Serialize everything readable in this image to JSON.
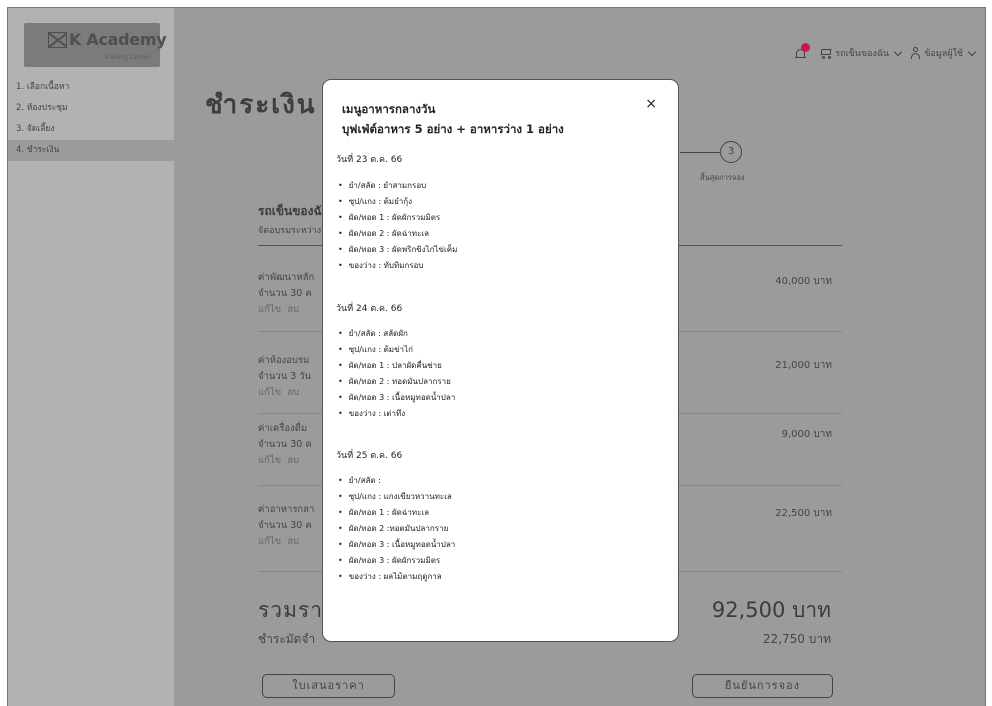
{
  "logo": {
    "name": "K Academy",
    "tagline": "Training Center"
  },
  "sidebar": {
    "items": [
      {
        "label": "1. เลือกเนื้อหา"
      },
      {
        "label": "2. ห้องประชุม"
      },
      {
        "label": "3. จัดเลี้ยง"
      },
      {
        "label": "4. ชำระเงิน"
      }
    ],
    "active_index": 3
  },
  "topbar": {
    "notification_color": "#c2185b",
    "cart_label": "รถเข็นของฉัน",
    "user_label": "ข้อมูลผู้ใช้"
  },
  "page": {
    "title": "ชำระเงิน",
    "stepper": {
      "step": "3",
      "label": "สิ้นสุดการจอง"
    },
    "section_title": "รถเข็นของฉัน",
    "section_sub": "จัดอบรมระหว่าง",
    "items": [
      {
        "line1": "ค่าพัฒนาหลัก",
        "line2": "จำนวน 30 ค",
        "edit": "แก้ไข",
        "remove": "ลบ",
        "price": "40,000 บาท"
      },
      {
        "line1": "ค่าห้องอบรม",
        "line2": "จำนวน 3 วัน",
        "edit": "แก้ไข",
        "remove": "ลบ",
        "price": "21,000 บาท"
      },
      {
        "line1": "ค่าเครื่องดื่ม",
        "line2": "จำนวน 30 ค",
        "edit": "แก้ไข",
        "remove": "ลบ",
        "price": "9,000 บาท"
      },
      {
        "line1": "ค่าอาหารกลา",
        "line2": "จำนวน 30 ค",
        "edit": "แก้ไข",
        "remove": "ลบ",
        "price": "22,500 บาท"
      }
    ],
    "total_label": "รวมราค",
    "total_value": "92,500 บาท",
    "deposit_label": "ชำระมัดจำ",
    "deposit_value": "22,750 บาท",
    "quote_button": "ใบเสนอราคา",
    "confirm_button": "ยืนยันการจอง"
  },
  "modal": {
    "title_line1": "เมนูอาหารกลางวัน",
    "title_line2": "บุฟเฟ่ต์อาหาร 5 อย่าง + อาหารว่าง 1 อย่าง",
    "close": "×",
    "days": [
      {
        "date": "วันที่ 23 ต.ค. 66",
        "items": [
          "ยำ/สลัด : ยำสามกรอบ",
          "ซุป/แกง : ต้มยำกุ้ง",
          "ผัด/ทอด 1 : ผัดผักรวมมิตร",
          "ผัด/ทอด  2 : ผัดฉ่าทะเล",
          "ผัด/ทอด  3 : ผัดพริกขิงไก่ไข่เค็ม",
          "ของว่าง : ทับทิมกรอบ"
        ]
      },
      {
        "date": "วันที่ 24 ต.ค. 66",
        "items": [
          "ยำ/สลัด : สลัดผัก",
          "ซุป/แกง : ต้มข่าไก่",
          "ผัด/ทอด 1 : ปลาผัดคื่นช่าย",
          "ผัด/ทอด  2 : ทอดมันปลากราย",
          "ผัด/ทอด  3 : เนื้อหมูทอดน้ำปลา",
          "ของว่าง : เต่าทึง"
        ]
      },
      {
        "date": "วันที่ 25 ต.ค. 66",
        "items": [
          "ยำ/สลัด :",
          "ซุป/แกง : แกงเขียวหวานทะเล",
          "ผัด/ทอด 1 : ผัดฉ่าทะเล",
          "ผัด/ทอด  2 :ทอดมันปลากราย",
          "ผัด/ทอด  3 : เนื้อหมูทอดน้ำปลา",
          "ผัด/ทอด  3 : ผัดผักรวมมิตร",
          "ของว่าง : ผลไม้ตามฤดูกาล"
        ]
      }
    ]
  }
}
